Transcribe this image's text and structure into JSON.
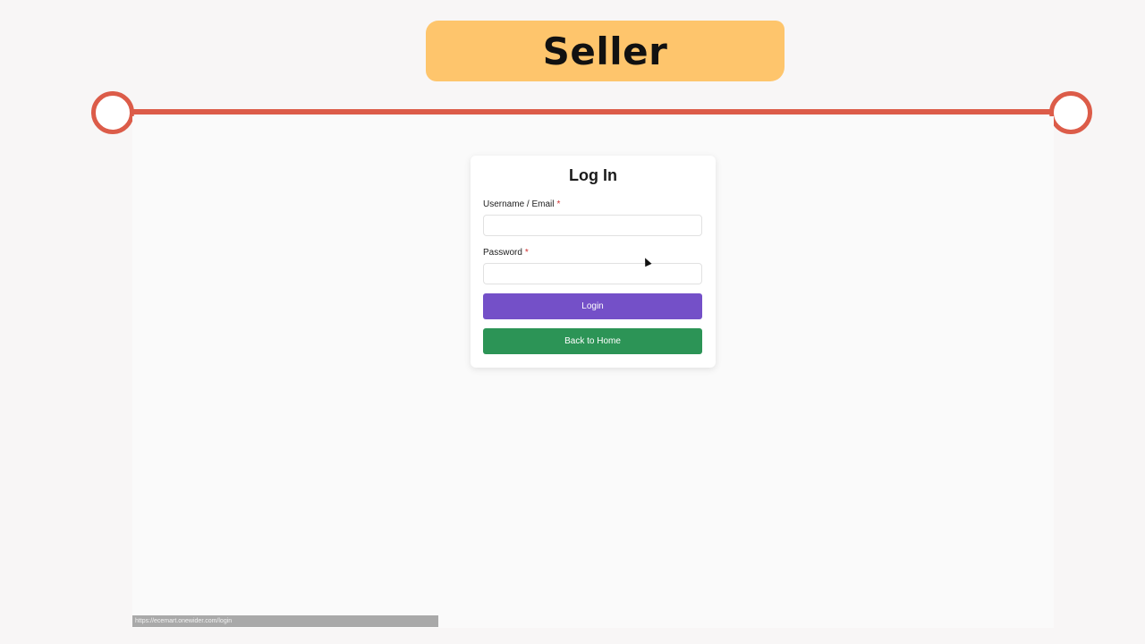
{
  "slide": {
    "title": "Seller"
  },
  "colors": {
    "banner": "#fec56c",
    "timeline": "#dc5c49",
    "login_button": "#7450c8",
    "home_button": "#2c9456"
  },
  "login_form": {
    "heading": "Log In",
    "username_label": "Username / Email",
    "password_label": "Password",
    "required_marker": "*",
    "username_value": "",
    "password_value": "",
    "login_button_label": "Login",
    "back_home_button_label": "Back to Home"
  },
  "status_bar": {
    "url": "https://ecemart.onewider.com/login"
  }
}
